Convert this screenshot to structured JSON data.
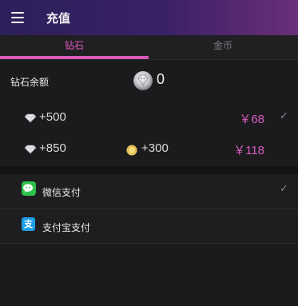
{
  "header": {
    "title": "充值",
    "menu_icon": "hamburger-menu-icon"
  },
  "tabs": [
    {
      "label": "钻石",
      "active": true
    },
    {
      "label": "金币",
      "active": false
    }
  ],
  "colors": {
    "accent": "#d85ab9",
    "price": "#d85bbf",
    "wechat": "#2fc04a",
    "alipay": "#1e9fe8"
  },
  "balance": {
    "label": "钻石余额",
    "value": "0",
    "icon": "diamond-icon"
  },
  "packages": [
    {
      "amount": "+500",
      "bonus": "",
      "price": "￥68",
      "selected": true
    },
    {
      "amount": "+850",
      "bonus": "+300",
      "price": "￥118",
      "selected": false
    }
  ],
  "payment": [
    {
      "label": "微信支付",
      "icon": "wechat-pay-icon",
      "selected": true
    },
    {
      "label": "支付宝支付",
      "icon": "alipay-icon",
      "selected": false
    }
  ],
  "alipay_glyph": "支",
  "check_glyph": "✓"
}
